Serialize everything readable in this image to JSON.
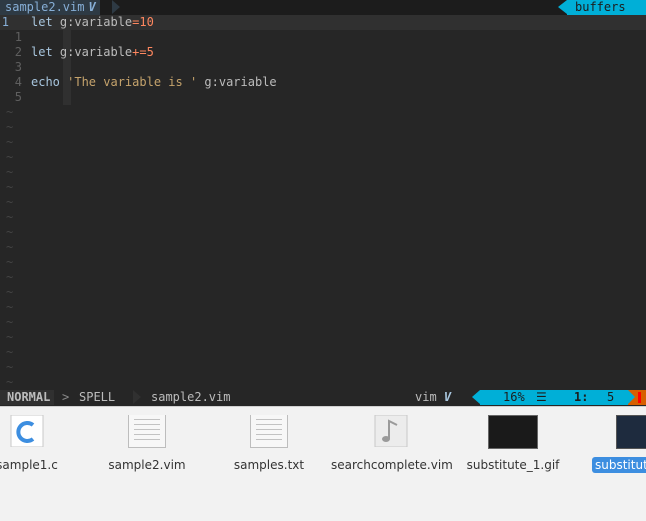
{
  "tabline": {
    "active_tab": "sample2.vim",
    "tab_marker": "V",
    "right_label": "buffers"
  },
  "editor": {
    "lines": [
      {
        "num": "1",
        "code_parts": [
          {
            "t": "let ",
            "c": "kw"
          },
          {
            "t": "g:variable",
            "c": ""
          },
          {
            "t": "=",
            "c": "op"
          },
          {
            "t": "10",
            "c": "num"
          }
        ]
      },
      {
        "num": "1",
        "code_parts": []
      },
      {
        "num": "2",
        "code_parts": [
          {
            "t": "let ",
            "c": "kw"
          },
          {
            "t": "g:variable",
            "c": ""
          },
          {
            "t": "+=",
            "c": "op"
          },
          {
            "t": "5",
            "c": "num"
          }
        ]
      },
      {
        "num": "3",
        "code_parts": []
      },
      {
        "num": "4",
        "code_parts": [
          {
            "t": "echo ",
            "c": "kw"
          },
          {
            "t": "'The variable is '",
            "c": "str"
          },
          {
            "t": " g:variable",
            "c": ""
          }
        ]
      },
      {
        "num": "5",
        "code_parts": []
      }
    ],
    "tilde": "~"
  },
  "statusline": {
    "mode": "NORMAL",
    "sep": ">",
    "spell": "SPELL",
    "filename": "sample2.vim",
    "filetype": "vim",
    "filetype_marker": "V",
    "percent": "16%",
    "lines_icon": "☰",
    "line_pos": "1:",
    "col_pos": "5"
  },
  "files": {
    "items": [
      {
        "name": "sample1.c",
        "icon": "c-source-icon"
      },
      {
        "name": "sample2.vim",
        "icon": "text-document-icon"
      },
      {
        "name": "samples.txt",
        "icon": "text-document-icon"
      },
      {
        "name": "searchcomplete.vim",
        "icon": "audio-file-icon"
      },
      {
        "name": "substitute_1.gif",
        "icon": "image-thumbnail-icon"
      },
      {
        "name": "substitute",
        "icon": "image-thumbnail-icon"
      }
    ],
    "selected": "substitute"
  },
  "colors": {
    "accent": "#00afd7",
    "background": "#262626",
    "warning": "#d75f00"
  }
}
